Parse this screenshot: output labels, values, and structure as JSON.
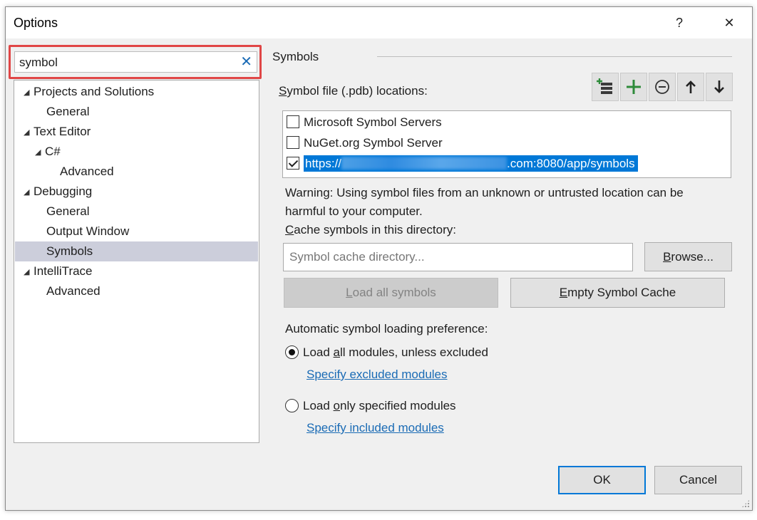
{
  "window": {
    "title": "Options",
    "help": "?",
    "close": "✕"
  },
  "search": {
    "value": "symbol",
    "clear": "✕"
  },
  "tree": {
    "items": [
      {
        "label": "Projects and Solutions",
        "expanded": true,
        "level": 0
      },
      {
        "label": "General",
        "level": 1
      },
      {
        "label": "Text Editor",
        "expanded": true,
        "level": 0
      },
      {
        "label": "C#",
        "expanded": true,
        "level": 1
      },
      {
        "label": "Advanced",
        "level": 2
      },
      {
        "label": "Debugging",
        "expanded": true,
        "level": 0
      },
      {
        "label": "General",
        "level": 1
      },
      {
        "label": "Output Window",
        "level": 1
      },
      {
        "label": "Symbols",
        "level": 1,
        "selected": true
      },
      {
        "label": "IntelliTrace",
        "expanded": true,
        "level": 0
      },
      {
        "label": "Advanced",
        "level": 1
      }
    ]
  },
  "symbols": {
    "title": "Symbols",
    "pdb_label_key": "S",
    "pdb_label_rest": "ymbol file (.pdb) locations:",
    "toolbar_icons": [
      "add-server-icon",
      "plus-icon",
      "minus-icon",
      "arrow-up-icon",
      "arrow-down-icon"
    ],
    "locations": [
      {
        "label": "Microsoft Symbol Servers",
        "checked": false
      },
      {
        "label": "NuGet.org Symbol Server",
        "checked": false
      },
      {
        "prefix": "https://",
        "suffix": ".com:8080/app/symbols",
        "checked": true,
        "selected": true
      }
    ],
    "warning": "Warning: Using symbol files from an unknown or untrusted location can be harmful to your computer.",
    "cache_label_key": "C",
    "cache_label_rest": "ache symbols in this directory:",
    "cache_placeholder": "Symbol cache directory...",
    "browse_key": "B",
    "browse_rest": "rowse...",
    "load_all_key": "L",
    "load_all_rest": "oad all symbols",
    "empty_cache_key": "E",
    "empty_cache_rest": "mpty Symbol Cache",
    "auto_label": "Automatic symbol loading preference:",
    "radio_all_pre": "Load ",
    "radio_all_key": "a",
    "radio_all_post": "ll modules, unless excluded",
    "link_excluded": "Specify excluded modules",
    "radio_only_pre": "Load ",
    "radio_only_key": "o",
    "radio_only_post": "nly specified modules",
    "link_included": "Specify included modules"
  },
  "footer": {
    "ok": "OK",
    "cancel": "Cancel"
  },
  "colors": {
    "accent": "#0078d7",
    "selection": "#cccedb",
    "search_highlight": "#e04646",
    "link": "#1a6bb5"
  }
}
